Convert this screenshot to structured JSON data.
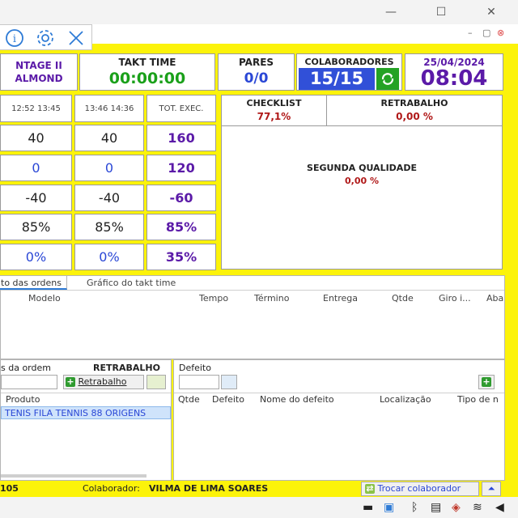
{
  "window": {
    "minimize": "—",
    "maximize": "☐",
    "close": "✕"
  },
  "inner_window": {
    "minimize": "–",
    "maximize": "▢",
    "close": "⊗"
  },
  "header": {
    "model_line1": "NTAGE II",
    "model_line2": "ALMOND",
    "takt_label": "TAKT TIME",
    "takt_value": "00:00:00",
    "pares_label": "PARES",
    "pares_value": "0/0",
    "colab_label": "COLABORADORES",
    "colab_value": "15/15",
    "date": "25/04/2024",
    "time": "08:04"
  },
  "production": {
    "columns": [
      "12:52 13:45",
      "13:46 14:36",
      "TOT. EXEC."
    ],
    "rows": [
      [
        "40",
        "40",
        "160"
      ],
      [
        "0",
        "0",
        "120"
      ],
      [
        "-40",
        "-40",
        "-60"
      ],
      [
        "85%",
        "85%",
        "85%"
      ],
      [
        "0%",
        "0%",
        "35%"
      ]
    ]
  },
  "quality": {
    "checklist_label": "CHECKLIST",
    "checklist_value": "77,1%",
    "retrabalho_label": "RETRABALHO",
    "retrabalho_value": "0,00 %",
    "segunda_label": "SEGUNDA QUALIDADE",
    "segunda_value": "0,00 %"
  },
  "tabs": {
    "tab1": "to das ordens",
    "tab2": "Gráfico do takt time",
    "headers": {
      "modelo": "Modelo",
      "tempo": "Tempo",
      "termino": "Término",
      "entrega": "Entrega",
      "qtde": "Qtde",
      "giro": "Giro i...",
      "aba": "Aba"
    }
  },
  "order": {
    "label": "s da ordem",
    "retrabalho_heading": "RETRABALHO",
    "retrabalho_button": "Retrabalho",
    "produto_header": "Produto",
    "produto_value": "TENIS FILA TENNIS 88 ORIGENS"
  },
  "defeito": {
    "label": "Defeito",
    "headers": {
      "qtde": "Qtde",
      "defeito": "Defeito",
      "nome": "Nome do defeito",
      "local": "Localização",
      "tipo": "Tipo de n"
    }
  },
  "footer": {
    "code": "105",
    "colab_label": "Colaborador:",
    "colab_name": "VILMA DE LIMA SOARES",
    "trocar_button": "Trocar colaborador"
  },
  "colors": {
    "yellow": "#fcf30a",
    "green": "#1aa01a",
    "purple": "#5b1aa8",
    "blue": "#2a47d6",
    "red": "#b01818"
  }
}
